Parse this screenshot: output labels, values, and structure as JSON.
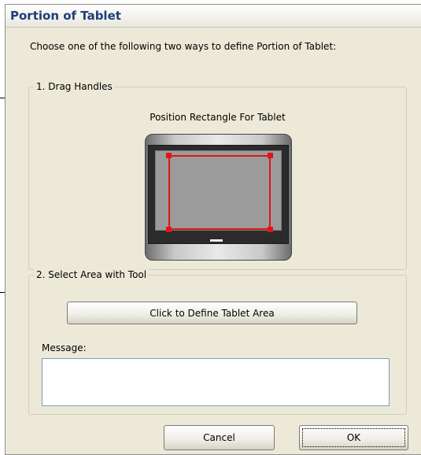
{
  "dialog": {
    "title": "Portion of Tablet",
    "instructions": "Choose one of the following two ways to define Portion of Tablet:"
  },
  "drag_handles": {
    "legend": "1. Drag Handles",
    "caption": "Position Rectangle For Tablet"
  },
  "select_area": {
    "legend": "2. Select Area with Tool",
    "define_button": "Click to Define Tablet Area",
    "message_label": "Message:",
    "message_value": ""
  },
  "footer": {
    "cancel_label": "Cancel",
    "ok_label": "OK"
  },
  "colors": {
    "selection": "#e01515",
    "title_text": "#1f3d7a",
    "dialog_bg": "#ece9d8"
  }
}
